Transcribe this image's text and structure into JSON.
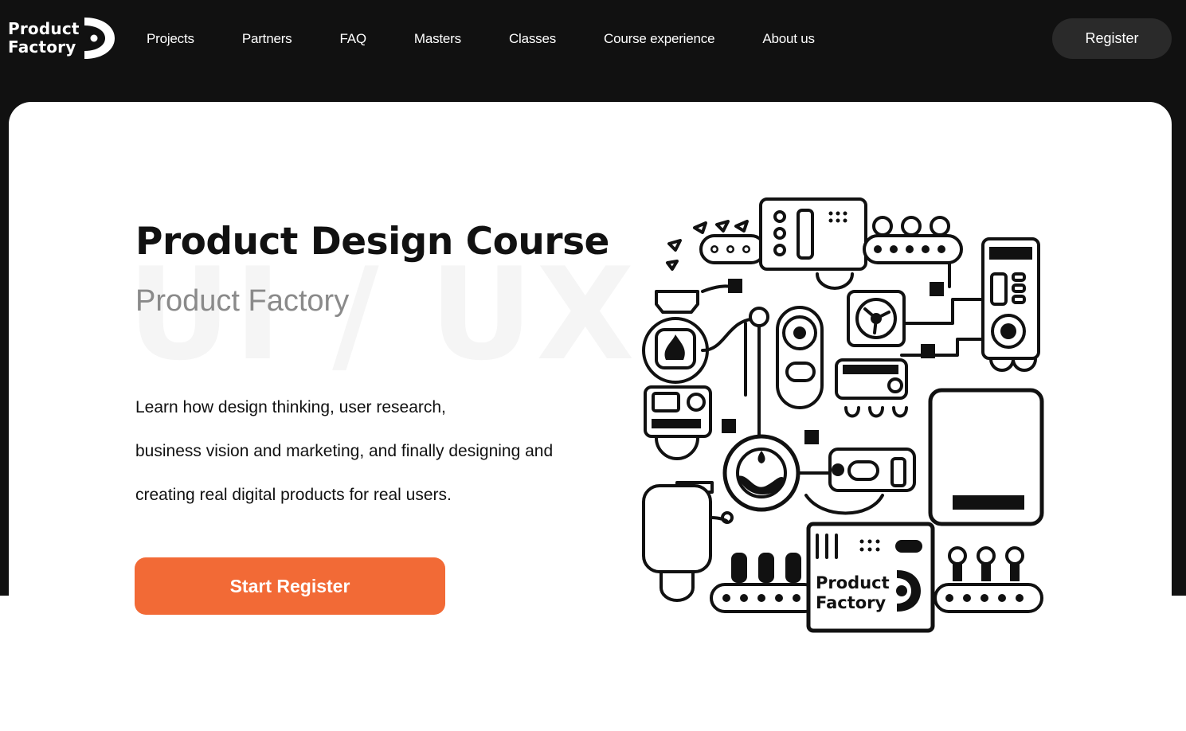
{
  "nav": {
    "logo_line1": "Product",
    "logo_line2": "Factory",
    "items": [
      "Projects",
      "Partners",
      "FAQ",
      "Masters",
      "Classes",
      "Course experience",
      "About us"
    ],
    "register_label": "Register"
  },
  "hero": {
    "title": "Product Design Course",
    "subtitle": "Product Factory",
    "watermark": "UI / UX",
    "description_lines": [
      "Learn how design thinking, user research,",
      "business vision and marketing, and finally designing and",
      "creating real digital products for real users."
    ],
    "cta_label": "Start Register"
  },
  "illustration": {
    "logo_line1": "Product",
    "logo_line2": "Factory"
  },
  "colors": {
    "background_dark": "#111111",
    "accent": "#f26a36",
    "register_button": "#2a2a2a"
  }
}
